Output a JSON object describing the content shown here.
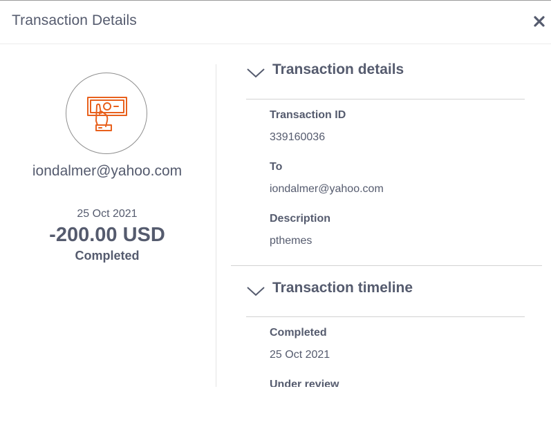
{
  "header": {
    "title": "Transaction Details",
    "close_icon": "close-icon"
  },
  "summary": {
    "icon": "cash-payment-icon",
    "icon_color": "#e8601c",
    "email": "iondalmer@yahoo.com",
    "date": "25 Oct 2021",
    "amount": "-200.00 USD",
    "status": "Completed"
  },
  "details": {
    "section_title": "Transaction details",
    "fields": [
      {
        "label": "Transaction ID",
        "value": "339160036"
      },
      {
        "label": "To",
        "value": "iondalmer@yahoo.com"
      },
      {
        "label": "Description",
        "value": "pthemes"
      }
    ]
  },
  "timeline": {
    "section_title": "Transaction timeline",
    "events": [
      {
        "label": "Completed",
        "value": "25 Oct 2021"
      },
      {
        "label": "Under review",
        "value": ""
      }
    ]
  }
}
